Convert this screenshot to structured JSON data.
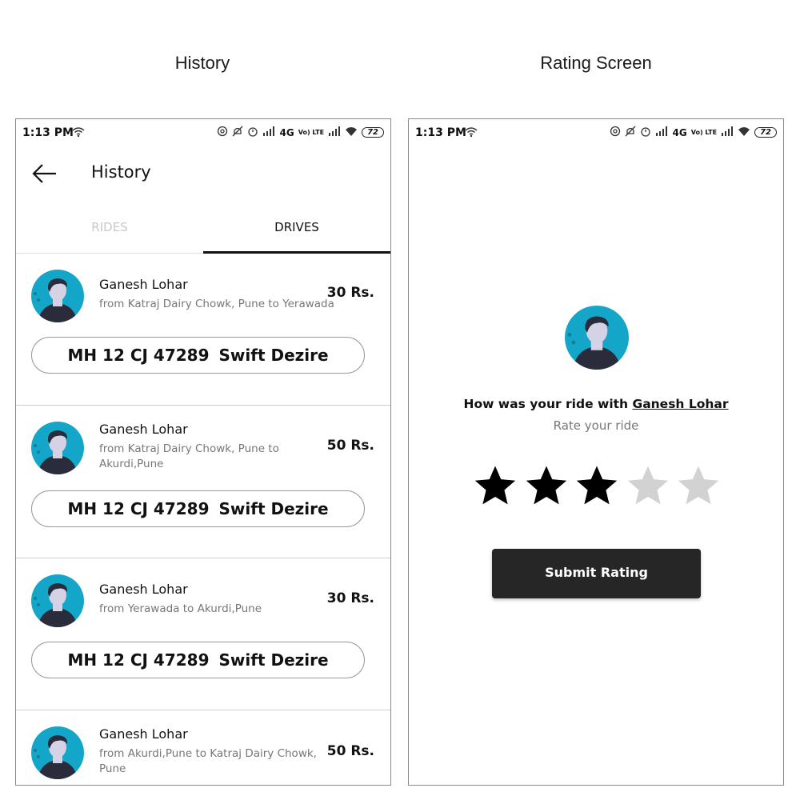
{
  "captions": {
    "left": "History",
    "right": "Rating Screen"
  },
  "status": {
    "time": "1:13 PM",
    "network": "4G",
    "volte": "Vo) LTE",
    "battery": "72"
  },
  "history": {
    "title": "History",
    "tabs": [
      {
        "label": "RIDES",
        "active": false
      },
      {
        "label": "DRIVES",
        "active": true
      }
    ],
    "items": [
      {
        "name": "Ganesh Lohar",
        "route": "from Katraj Dairy Chowk, Pune to Yerawada",
        "price": "30 Rs.",
        "plate": "MH 12 CJ 47289",
        "car": "Swift Dezire"
      },
      {
        "name": "Ganesh Lohar",
        "route": "from Katraj Dairy Chowk, Pune to Akurdi,Pune",
        "price": "50 Rs.",
        "plate": "MH 12 CJ 47289",
        "car": "Swift Dezire"
      },
      {
        "name": "Ganesh Lohar",
        "route": "from Yerawada to Akurdi,Pune",
        "price": "30 Rs.",
        "plate": "MH 12 CJ 47289",
        "car": "Swift Dezire"
      },
      {
        "name": "Ganesh Lohar",
        "route": "from Akurdi,Pune to Katraj Dairy Chowk, Pune",
        "price": "50 Rs."
      }
    ]
  },
  "rating": {
    "question_prefix": "How was your ride with ",
    "driver": "Ganesh Lohar",
    "subtitle": "Rate your ride",
    "stars_filled": 3,
    "stars_total": 5,
    "submit_label": "Submit Rating"
  },
  "icons": {
    "back": "arrow-left-icon",
    "star": "star-icon",
    "avatar": "avatar-icon",
    "wifi": "wifi-icon",
    "signal": "signal-icon",
    "alarm": "alarm-icon"
  },
  "colors": {
    "avatar_bg": "#14a6c8",
    "button_bg": "#262626",
    "star_filled": "#000000",
    "star_empty": "#d2d2d2"
  }
}
